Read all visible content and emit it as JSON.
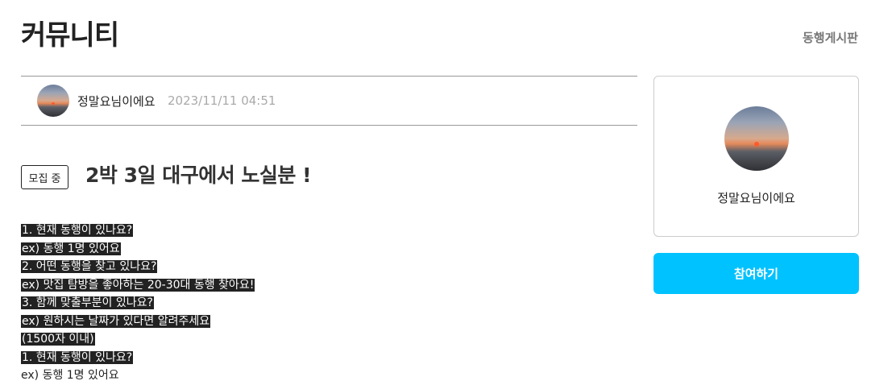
{
  "header": {
    "title": "커뮤니티",
    "breadcrumb": "동행게시판"
  },
  "post": {
    "author": "정말요님이에요",
    "date": "2023/11/11 04:51",
    "status": "모집 중",
    "title": "2박 3일 대구에서 노실분 !",
    "body_lines": [
      {
        "text": "1. 현재 동행이 있나요?",
        "highlight": true
      },
      {
        "text": "ex) 동행 1명 있어요",
        "highlight": true
      },
      {
        "text": "2. 어떤 동행을 찾고 있나요?",
        "highlight": true
      },
      {
        "text": "ex) 맛집 탐방을 좋아하는 20-30대 동행 찾아요!",
        "highlight": true
      },
      {
        "text": "3. 함께 맞출부분이 있나요?",
        "highlight": true
      },
      {
        "text": "ex) 원하시는 날짜가 있다면 알려주세요",
        "highlight": true
      },
      {
        "text": "(1500자 이내)",
        "highlight": true
      },
      {
        "text": "1. 현재 동행이 있나요?",
        "highlight": true
      },
      {
        "text": "ex) 동행 1명 있어요",
        "highlight": false
      }
    ]
  },
  "sidebar": {
    "profile_name": "정말요님이에요",
    "join_label": "참여하기"
  },
  "colors": {
    "accent": "#00c2ff",
    "highlight_bg": "#222222"
  }
}
